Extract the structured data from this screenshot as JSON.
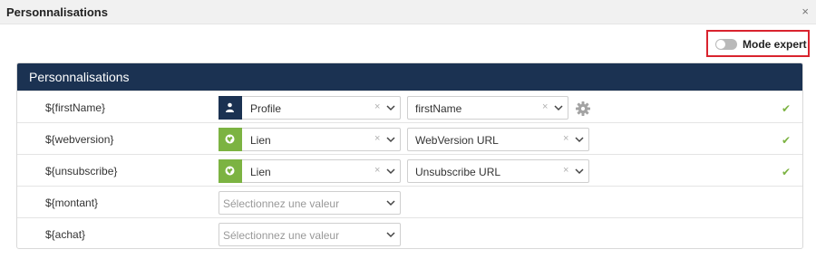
{
  "dialog": {
    "title": "Personnalisations",
    "close_glyph": "×"
  },
  "expert_mode": {
    "label": "Mode expert",
    "enabled": false
  },
  "panel": {
    "title": "Personnalisations"
  },
  "rows": [
    {
      "variable": "${firstName}",
      "source": "Profile",
      "source_icon": "user-icon",
      "field": "firstName",
      "has_settings": true,
      "status": "valid"
    },
    {
      "variable": "${webversion}",
      "source": "Lien",
      "source_icon": "link-globe-icon",
      "field": "WebVersion URL",
      "has_settings": false,
      "status": "valid"
    },
    {
      "variable": "${unsubscribe}",
      "source": "Lien",
      "source_icon": "link-globe-icon",
      "field": "Unsubscribe URL",
      "has_settings": false,
      "status": "valid"
    },
    {
      "variable": "${montant}",
      "placeholder": "Sélectionnez une valeur"
    },
    {
      "variable": "${achat}",
      "placeholder": "Sélectionnez une valeur"
    }
  ],
  "glyphs": {
    "clear": "×",
    "check": "✔"
  },
  "colors": {
    "header": "#1b3252",
    "profile_badge": "#1b3252",
    "link_badge": "#7cb342",
    "check": "#7cb342",
    "highlight": "#d9232e"
  }
}
